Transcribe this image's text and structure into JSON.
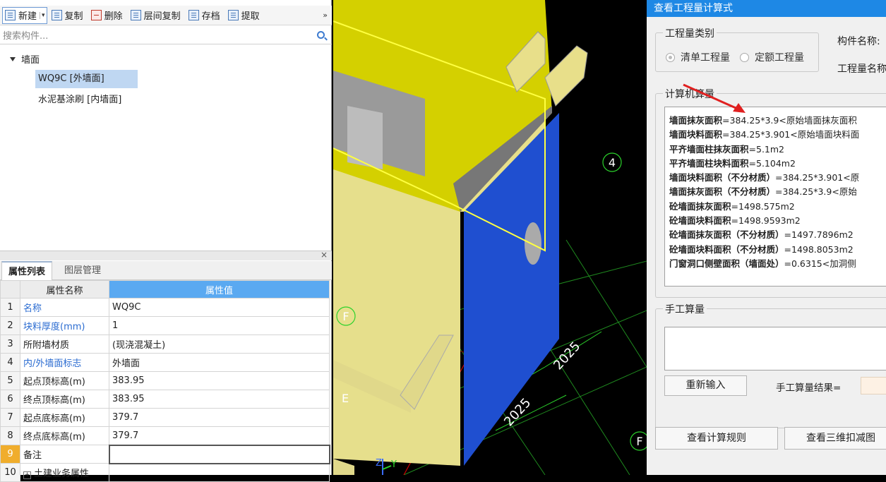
{
  "toolbar": {
    "items": [
      {
        "label": "新建",
        "icon": "new-doc-icon"
      },
      {
        "label": "复制",
        "icon": "copy-icon"
      },
      {
        "label": "删除",
        "icon": "delete-icon"
      },
      {
        "label": "层间复制",
        "icon": "layer-copy-icon"
      },
      {
        "label": "存档",
        "icon": "archive-icon"
      },
      {
        "label": "提取",
        "icon": "extract-icon"
      }
    ],
    "more": "»"
  },
  "search": {
    "placeholder": "搜索构件..."
  },
  "tree": {
    "root": "墙面",
    "children": [
      "WQ9C [外墙面]",
      "水泥基涂刷 [内墙面]"
    ]
  },
  "properties": {
    "close": "×",
    "tabs": [
      "属性列表",
      "图层管理"
    ],
    "col_name": "属性名称",
    "col_value": "属性值",
    "rows": [
      {
        "idx": "1",
        "name": "名称",
        "value": "WQ9C"
      },
      {
        "idx": "2",
        "name": "块料厚度(mm)",
        "value": "1"
      },
      {
        "idx": "3",
        "name": "所附墙材质",
        "value": "(现浇混凝土)"
      },
      {
        "idx": "4",
        "name": "内/外墙面标志",
        "value": "外墙面"
      },
      {
        "idx": "5",
        "name": "起点顶标高(m)",
        "value": "383.95"
      },
      {
        "idx": "6",
        "name": "终点顶标高(m)",
        "value": "383.95"
      },
      {
        "idx": "7",
        "name": "起点底标高(m)",
        "value": "379.7"
      },
      {
        "idx": "8",
        "name": "终点底标高(m)",
        "value": "379.7"
      },
      {
        "idx": "9",
        "name": "备注",
        "value": ""
      },
      {
        "idx": "10",
        "name": "土建业务属性",
        "value": ""
      }
    ]
  },
  "viewport": {
    "axis_labels": [
      "4",
      "F",
      "F",
      "E"
    ],
    "dimensions": [
      "2025",
      "2025"
    ],
    "gizmo": [
      "Z",
      "Y"
    ]
  },
  "dialog": {
    "title": "查看工程量计算式",
    "qty_type_legend": "工程量类别",
    "radio_1": "清单工程量",
    "radio_2": "定额工程量",
    "component_name": "构件名称:",
    "qty_name": "工程量名称",
    "calc_legend": "计算机算量",
    "calc_lines": [
      {
        "name": "墙面抹灰面积",
        "expr": "=384.25*3.9<原始墙面抹灰面积"
      },
      {
        "name": "墙面块料面积",
        "expr": "=384.25*3.901<原始墙面块料面"
      },
      {
        "name": "平齐墙面柱抹灰面积",
        "expr": "=5.1m2"
      },
      {
        "name": "平齐墙面柱块料面积",
        "expr": "=5.104m2"
      },
      {
        "name": "墙面块料面积（不分材质）",
        "expr": "=384.25*3.901<原"
      },
      {
        "name": "墙面抹灰面积（不分材质）",
        "expr": "=384.25*3.9<原始"
      },
      {
        "name": "砼墙面抹灰面积",
        "expr": "=1498.575m2"
      },
      {
        "name": "砼墙面块料面积",
        "expr": "=1498.9593m2"
      },
      {
        "name": "砼墙面抹灰面积（不分材质）",
        "expr": "=1497.7896m2"
      },
      {
        "name": "砼墙面块料面积（不分材质）",
        "expr": "=1498.8053m2"
      },
      {
        "name": "门窗洞口侧壁面积（墙面处）",
        "expr": "=0.6315<加洞侧"
      }
    ],
    "manual_legend": "手工算量",
    "reset": "重新输入",
    "manual_result": "手工算量结果=",
    "view_rules": "查看计算规则",
    "view_3d": "查看三维扣减图"
  },
  "colors": {
    "title_bar": "#1e88e5",
    "header_value": "#5aa9f1",
    "selected_row": "#f0ad2c",
    "wall_yellow": "#d4d000",
    "wall_blue": "#1f4fd0"
  }
}
